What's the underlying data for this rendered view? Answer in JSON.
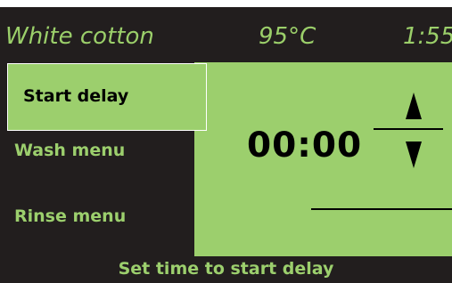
{
  "header": {
    "program": "White cotton",
    "temperature": "95°C",
    "duration": "1:55"
  },
  "menu": {
    "items": [
      {
        "label": "Start delay",
        "selected": true
      },
      {
        "label": "Wash menu",
        "selected": false
      },
      {
        "label": "Rinse menu",
        "selected": false
      }
    ]
  },
  "panel": {
    "time_value": "00:00",
    "up_icon": "arrow-up-icon",
    "down_icon": "arrow-down-icon"
  },
  "status": {
    "text": "Set time to start delay"
  },
  "colors": {
    "background": "#221e1e",
    "accent_green": "#9ccf6d",
    "text_dark": "#000000"
  }
}
